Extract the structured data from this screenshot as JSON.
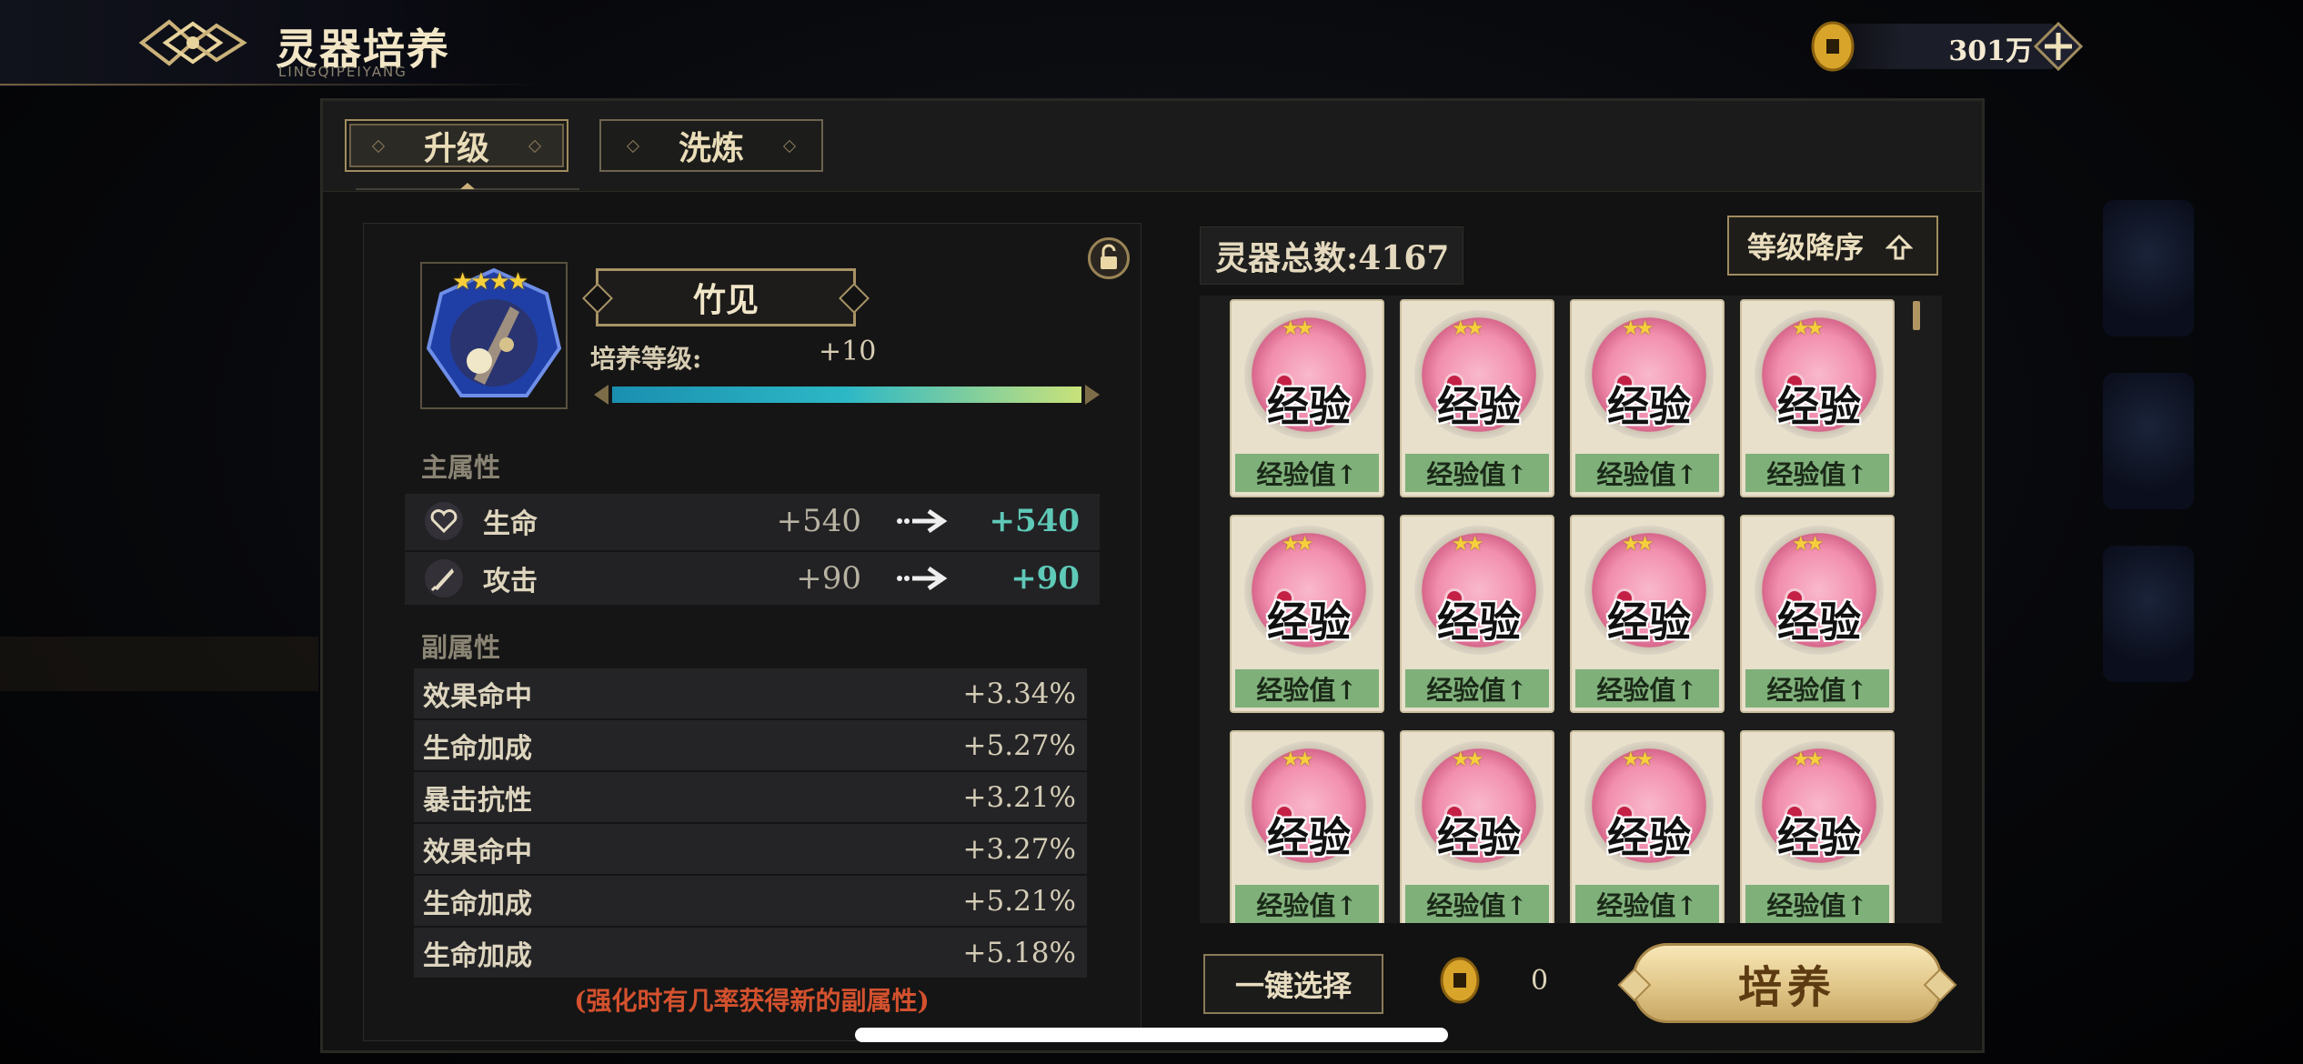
{
  "header": {
    "title": "灵器培养",
    "subtitle": "LINGQIPEIYANG"
  },
  "currency": {
    "value": "301万"
  },
  "tabs": [
    {
      "label": "升级",
      "active": true
    },
    {
      "label": "洗炼",
      "active": false
    }
  ],
  "item": {
    "name": "竹见",
    "stars": 4,
    "level_label": "培养等级:",
    "level_value": "+10",
    "level_progress": 1.0
  },
  "main_attrs": {
    "label": "主属性",
    "rows": [
      {
        "icon": "heart-icon",
        "name": "生命",
        "current": "+540",
        "next": "+540"
      },
      {
        "icon": "blade-icon",
        "name": "攻击",
        "current": "+90",
        "next": "+90"
      }
    ]
  },
  "sub_attrs": {
    "label": "副属性",
    "rows": [
      {
        "name": "效果命中",
        "value": "+3.34%"
      },
      {
        "name": "生命加成",
        "value": "+5.27%"
      },
      {
        "name": "暴击抗性",
        "value": "+3.21%"
      },
      {
        "name": "效果命中",
        "value": "+3.27%"
      },
      {
        "name": "生命加成",
        "value": "+5.21%"
      },
      {
        "name": "生命加成",
        "value": "+5.18%"
      }
    ],
    "hint": "(强化时有几率获得新的副属性)"
  },
  "inventory": {
    "total_label": "灵器总数:4167",
    "sort_label": "等级降序",
    "cards": [
      {
        "orb_text": "经验",
        "foot": "经验值↑"
      },
      {
        "orb_text": "经验",
        "foot": "经验值↑"
      },
      {
        "orb_text": "经验",
        "foot": "经验值↑"
      },
      {
        "orb_text": "经验",
        "foot": "经验值↑"
      },
      {
        "orb_text": "经验",
        "foot": "经验值↑"
      },
      {
        "orb_text": "经验",
        "foot": "经验值↑"
      },
      {
        "orb_text": "经验",
        "foot": "经验值↑"
      },
      {
        "orb_text": "经验",
        "foot": "经验值↑"
      },
      {
        "orb_text": "经验",
        "foot": "经验值↑"
      },
      {
        "orb_text": "经验",
        "foot": "经验值↑"
      },
      {
        "orb_text": "经验",
        "foot": "经验值↑"
      },
      {
        "orb_text": "经验",
        "foot": "经验值↑"
      }
    ]
  },
  "actions": {
    "quick_select": "一键选择",
    "cost": "0",
    "train": "培养"
  },
  "colors": {
    "accent_gold": "#a08c5e",
    "next_value": "#5fc9b8",
    "hint_red": "#d3512e",
    "card_foot_green": "#7fb07a"
  }
}
